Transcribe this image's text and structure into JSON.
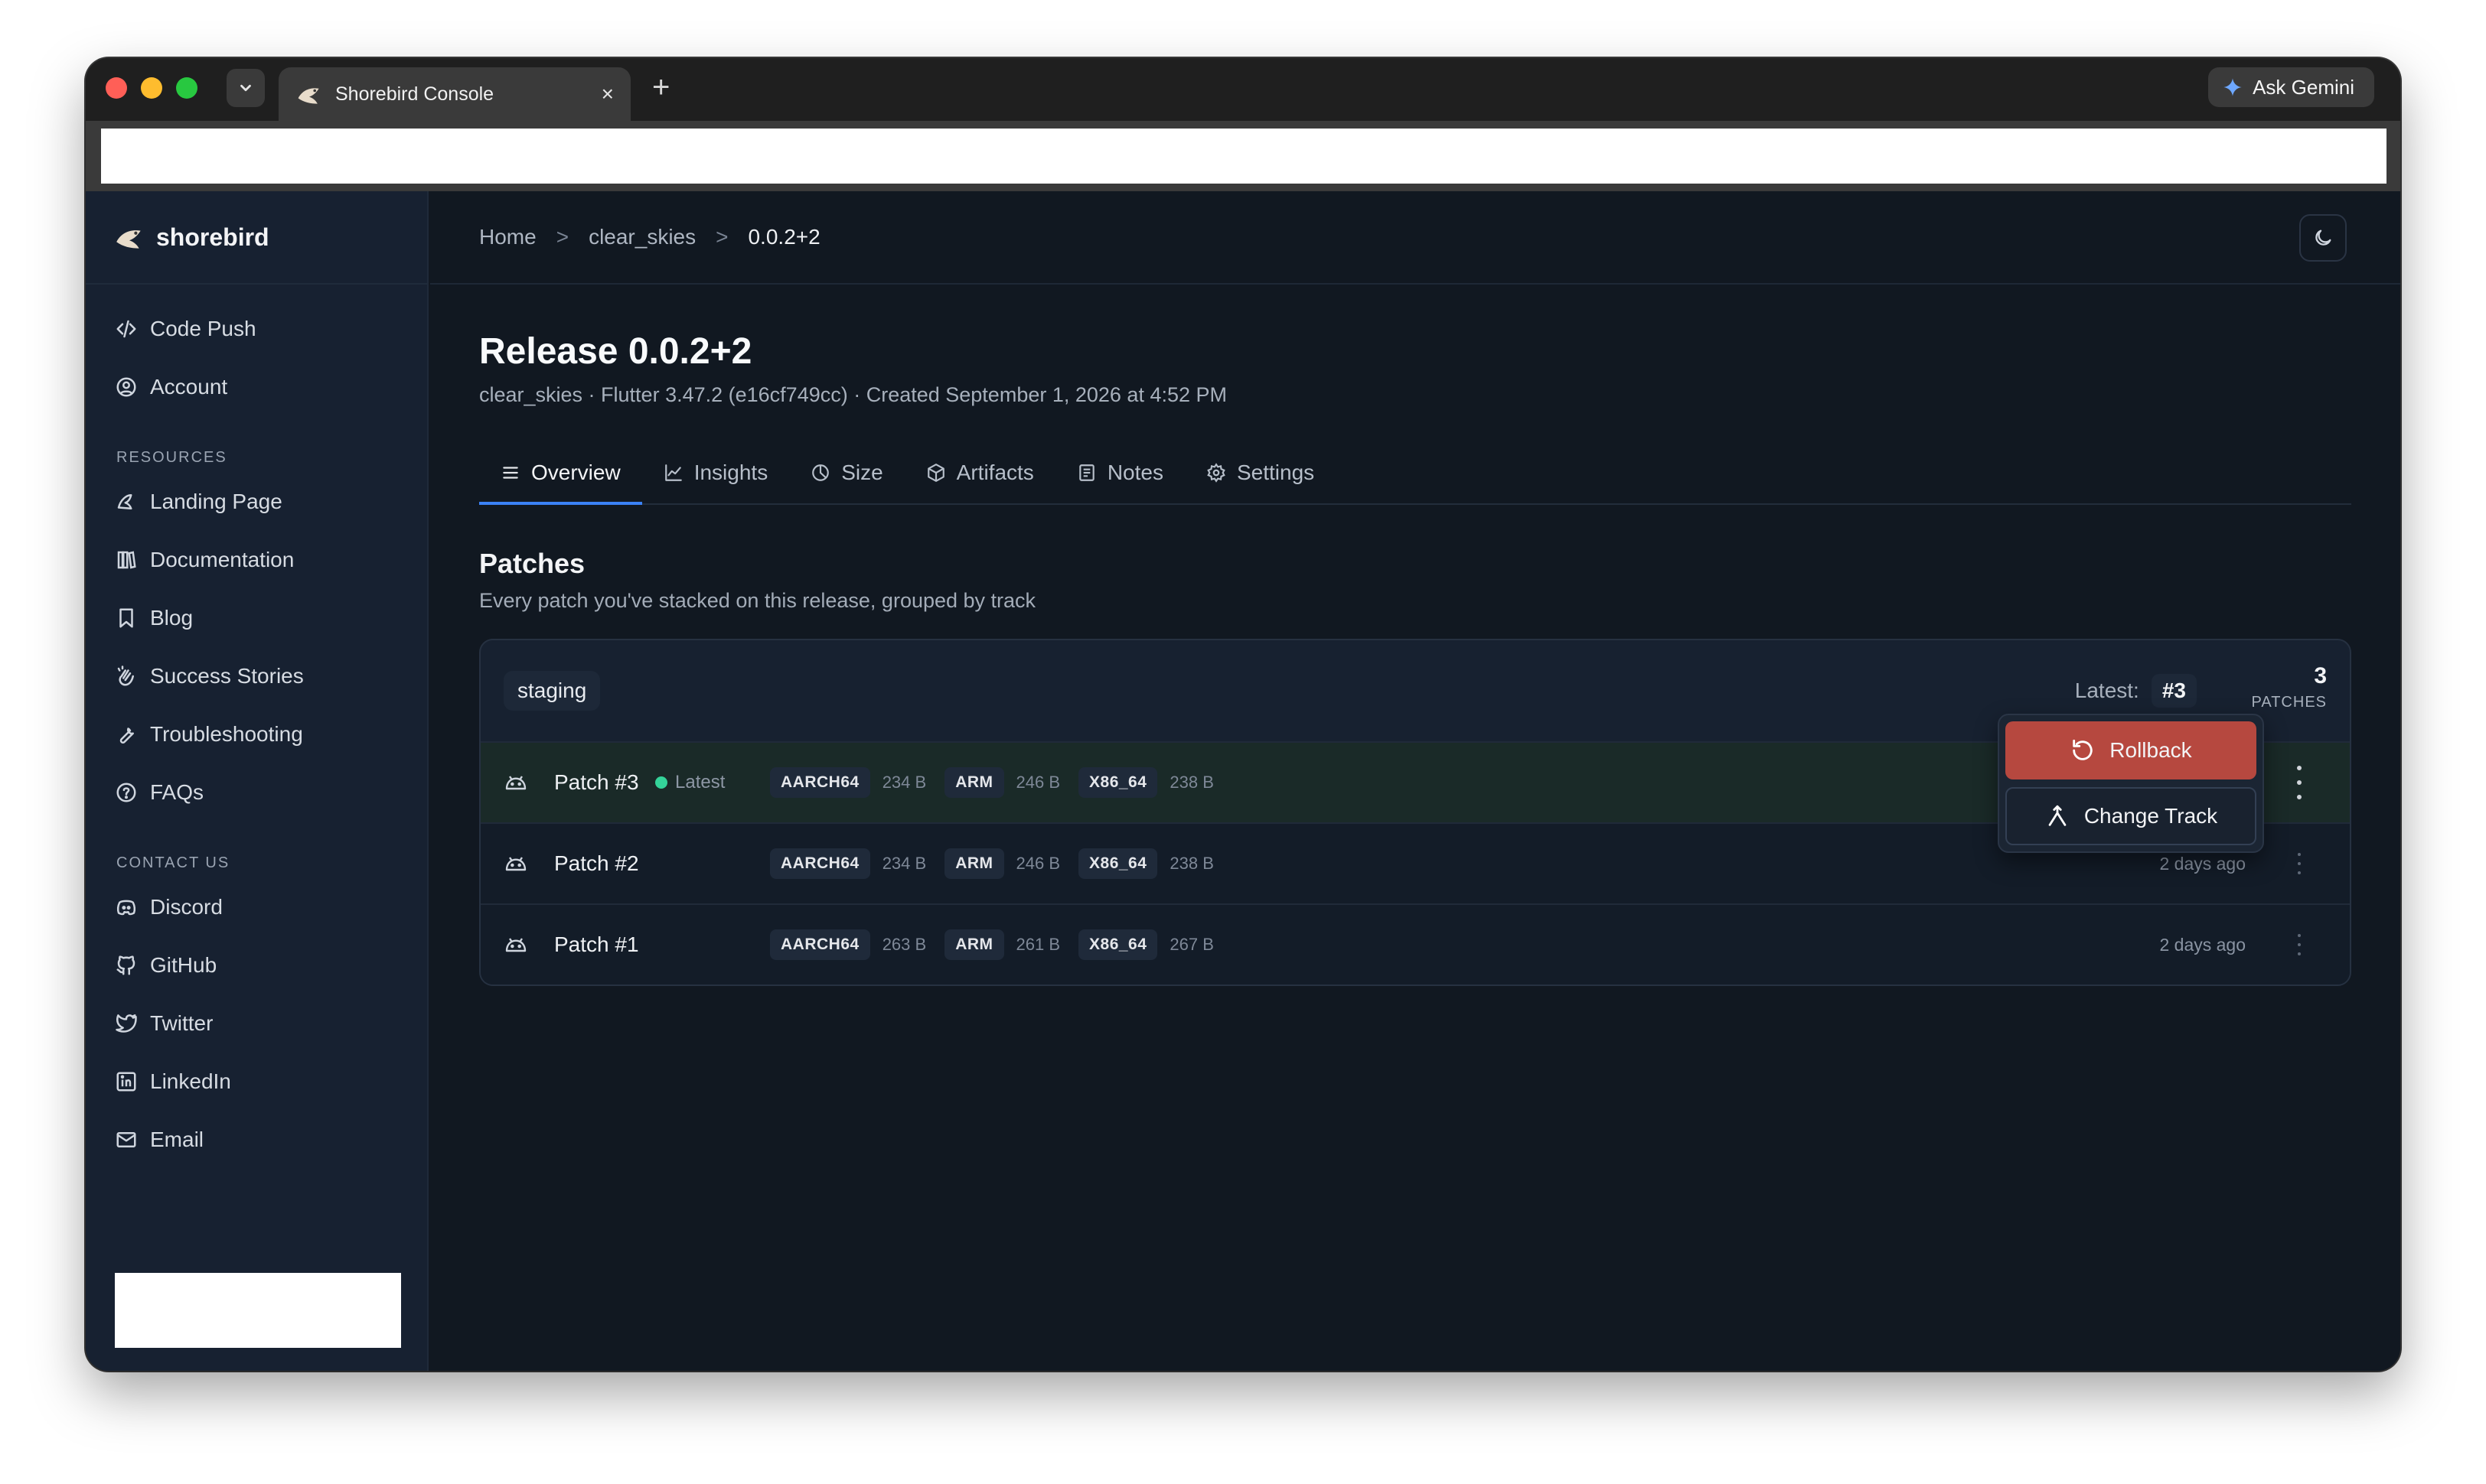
{
  "browser": {
    "tab_title": "Shorebird Console",
    "tab_close": "×",
    "new_tab": "+",
    "gemini_label": "Ask Gemini"
  },
  "sidebar": {
    "brand": "shorebird",
    "items": [
      {
        "label": "Code Push",
        "icon": "code-icon"
      },
      {
        "label": "Account",
        "icon": "account-icon"
      }
    ],
    "resources_heading": "RESOURCES",
    "resources": [
      {
        "label": "Landing Page",
        "icon": "bird-icon"
      },
      {
        "label": "Documentation",
        "icon": "books-icon"
      },
      {
        "label": "Blog",
        "icon": "bookmark-icon"
      },
      {
        "label": "Success Stories",
        "icon": "clap-icon"
      },
      {
        "label": "Troubleshooting",
        "icon": "wrench-icon"
      },
      {
        "label": "FAQs",
        "icon": "help-icon"
      }
    ],
    "contact_heading": "CONTACT US",
    "contact": [
      {
        "label": "Discord",
        "icon": "discord-icon"
      },
      {
        "label": "GitHub",
        "icon": "github-icon"
      },
      {
        "label": "Twitter",
        "icon": "twitter-icon"
      },
      {
        "label": "LinkedIn",
        "icon": "linkedin-icon"
      },
      {
        "label": "Email",
        "icon": "mail-icon"
      }
    ]
  },
  "breadcrumb": {
    "home": "Home",
    "app": "clear_skies",
    "release": "0.0.2+2",
    "separator": ">"
  },
  "release": {
    "title": "Release 0.0.2+2",
    "subtitle": "clear_skies · Flutter 3.47.2 (e16cf749cc) · Created September 1, 2026 at 4:52 PM"
  },
  "tabs": [
    {
      "label": "Overview",
      "active": true
    },
    {
      "label": "Insights"
    },
    {
      "label": "Size"
    },
    {
      "label": "Artifacts"
    },
    {
      "label": "Notes"
    },
    {
      "label": "Settings"
    }
  ],
  "patches_section": {
    "title": "Patches",
    "subtitle": "Every patch you've stacked on this release, grouped by track"
  },
  "track": {
    "name": "staging",
    "latest_label": "Latest:",
    "latest_value": "#3",
    "count": "3",
    "count_label": "PATCHES"
  },
  "patches": [
    {
      "name": "Patch #3",
      "latest_label": "Latest",
      "archs": [
        {
          "name": "AARCH64",
          "size": "234 B"
        },
        {
          "name": "ARM",
          "size": "246 B"
        },
        {
          "name": "X86_64",
          "size": "238 B"
        }
      ],
      "ago": ""
    },
    {
      "name": "Patch #2",
      "archs": [
        {
          "name": "AARCH64",
          "size": "234 B"
        },
        {
          "name": "ARM",
          "size": "246 B"
        },
        {
          "name": "X86_64",
          "size": "238 B"
        }
      ],
      "ago": "2 days ago"
    },
    {
      "name": "Patch #1",
      "archs": [
        {
          "name": "AARCH64",
          "size": "263 B"
        },
        {
          "name": "ARM",
          "size": "261 B"
        },
        {
          "name": "X86_64",
          "size": "267 B"
        }
      ],
      "ago": "2 days ago"
    }
  ],
  "menu": {
    "rollback": "Rollback",
    "change_track": "Change Track"
  },
  "colors": {
    "accent": "#3b82f6",
    "danger": "#b6483f",
    "latest_dot": "#34d399"
  }
}
